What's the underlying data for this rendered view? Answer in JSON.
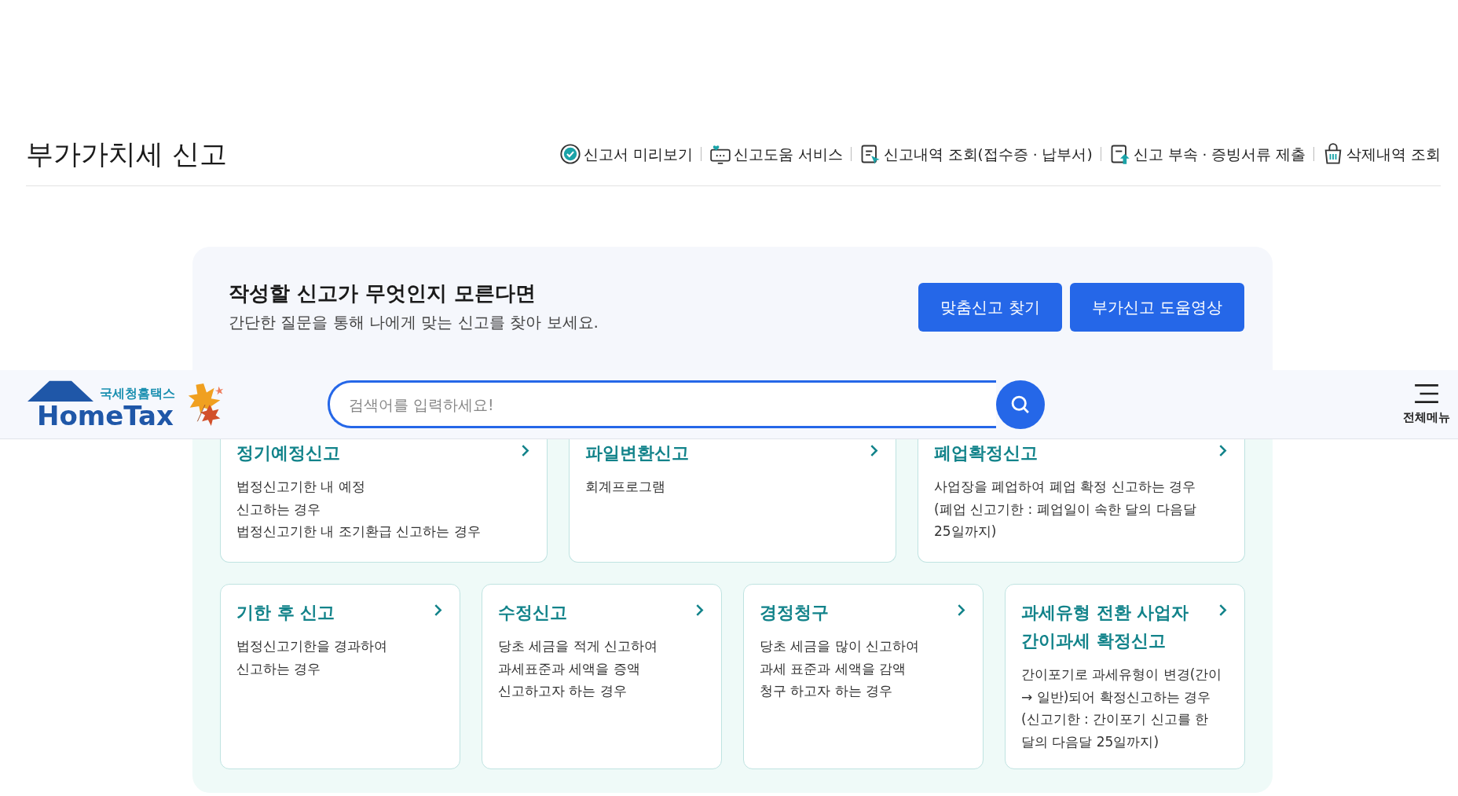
{
  "page_title": "부가가치세 신고",
  "quick_links": [
    {
      "label": "신고서 미리보기"
    },
    {
      "label": "신고도움 서비스"
    },
    {
      "label": "신고내역 조회(접수증 · 납부서)"
    },
    {
      "label": "신고 부속 · 증빙서류 제출"
    },
    {
      "label": "삭제내역 조회"
    }
  ],
  "guide": {
    "heading": "작성할 신고가 무엇인지 모른다면",
    "text": "간단한 질문을 통해 나에게 맞는 신고를 찾아 보세요.",
    "buttons": [
      "맞춤신고 찾기",
      "부가신고 도움영상"
    ]
  },
  "header": {
    "logo_subtitle": "국세청홈택스",
    "logo_title": "HomeTax",
    "search": {
      "placeholder": "검색어를 입력하세요!"
    },
    "menu_label": "전체메뉴"
  },
  "card_rows": [
    [
      {
        "title": "정기예정신고",
        "lines": [
          "법정신고기한 내 예정",
          "신고하는 경우",
          "법정신고기한 내 조기환급 신고하는 경우"
        ]
      },
      {
        "title": "파일변환신고",
        "lines": [
          "회계프로그램"
        ]
      },
      {
        "title": "폐업확정신고",
        "lines": [
          "사업장을 폐업하여 폐업 확정 신고하는 경우",
          "(폐업 신고기한 : 폐업일이 속한 달의 다음달",
          "25일까지)"
        ]
      }
    ],
    [
      {
        "title": "기한 후 신고",
        "lines": [
          "법정신고기한을 경과하여",
          "신고하는 경우"
        ]
      },
      {
        "title": "수정신고",
        "lines": [
          "당초 세금을 적게 신고하여",
          "과세표준과 세액을 증액",
          "신고하고자 하는 경우"
        ]
      },
      {
        "title": "경정청구",
        "lines": [
          "당초 세금을 많이 신고하여",
          "과세 표준과 세액을 감액",
          "청구 하고자 하는 경우"
        ]
      },
      {
        "title": "과세유형 전환 사업자 간이과세 확정신고",
        "lines": [
          "간이포기로 과세유형이 변경(간이",
          "→ 일반)되어 확정신고하는 경우",
          "(신고기한 : 간이포기 신고를 한",
          "달의 다음달 25일까지)"
        ]
      }
    ]
  ]
}
